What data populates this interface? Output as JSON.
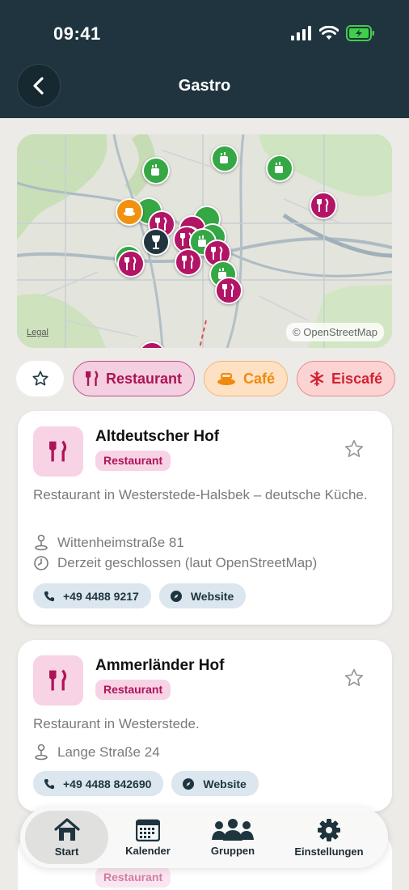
{
  "status_bar": {
    "time": "09:41"
  },
  "header": {
    "title": "Gastro"
  },
  "map": {
    "legal": "Legal",
    "attribution": "© OpenStreetMap"
  },
  "filters": [
    {
      "label": "Restaurant"
    },
    {
      "label": "Café"
    },
    {
      "label": "Eiscafé"
    }
  ],
  "cards": [
    {
      "title": "Altdeutscher Hof",
      "tag": "Restaurant",
      "description": "Restaurant in Westerstede-Halsbek – deutsche Küche.",
      "address": "Wittenheimstraße 81",
      "hours": "Derzeit geschlossen (laut OpenStreetMap)",
      "phone": "+49 4488 9217",
      "website": "Website"
    },
    {
      "title": "Ammerländer Hof",
      "tag": "Restaurant",
      "description": "Restaurant in Westerstede.",
      "address": "Lange Straße 24",
      "phone": "+49 4488 842690",
      "website": "Website"
    },
    {
      "tag": "Restaurant"
    }
  ],
  "tabbar": {
    "items": [
      {
        "label": "Start"
      },
      {
        "label": "Kalender"
      },
      {
        "label": "Gruppen"
      },
      {
        "label": "Einstellungen"
      }
    ]
  },
  "colors": {
    "header_bg": "#1f343e",
    "restaurant": "#b31566",
    "cafe": "#f0920f",
    "eiscafe": "#d32232",
    "green_marker": "#35a845"
  }
}
